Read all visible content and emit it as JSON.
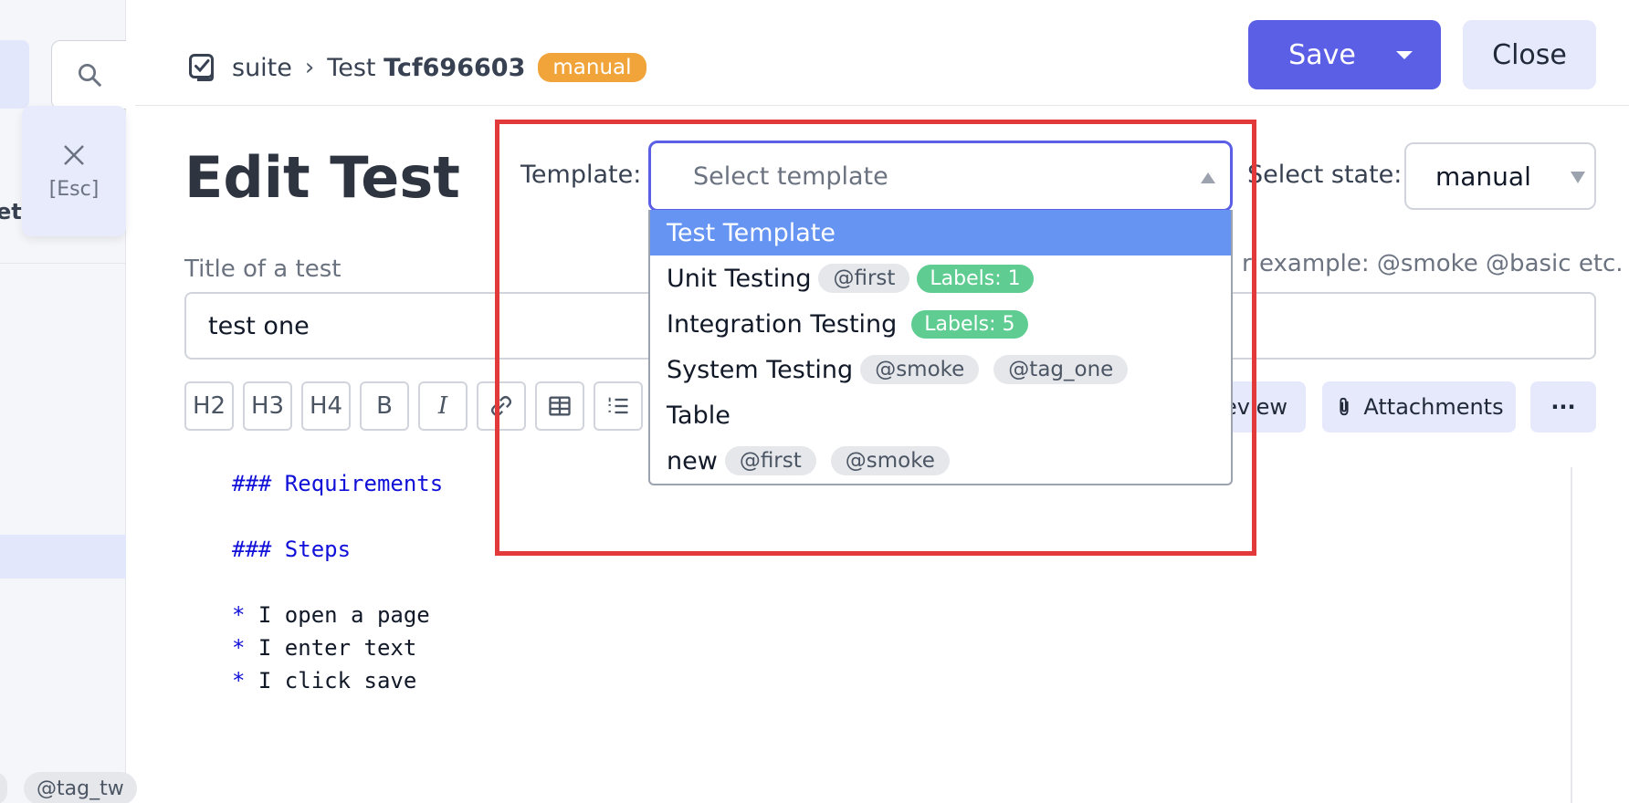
{
  "background": {
    "esc_label": "[Esc]",
    "cut_text": "eta",
    "tag_partial": "@tag_tw"
  },
  "header": {
    "breadcrumb_suite": "suite",
    "breadcrumb_separator": "›",
    "breadcrumb_test_prefix": "Test",
    "breadcrumb_test_id": "Tcf696603",
    "state_badge": "manual",
    "save_label": "Save",
    "close_label": "Close"
  },
  "main": {
    "page_title": "Edit Test",
    "template_label": "Template:",
    "template_placeholder": "Select template",
    "state_label": "Select state:",
    "state_value": "manual",
    "title_label": "Title of a test",
    "tags_hint": "r example: @smoke @basic etc.",
    "title_value": "test one",
    "toolbar": {
      "h2": "H2",
      "h3": "H3",
      "h4": "H4",
      "bold": "B",
      "italic": "I",
      "preview_label": "eview",
      "attachments_label": "Attachments",
      "more_label": "···"
    },
    "editor_lines": [
      {
        "star": "",
        "text": "### Requirements",
        "kind": "head"
      },
      {
        "star": "",
        "text": "### Steps",
        "kind": "head"
      },
      {
        "star": "*",
        "text": " I open a page",
        "kind": "item"
      },
      {
        "star": "*",
        "text": " I enter text",
        "kind": "item"
      },
      {
        "star": "*",
        "text": " I click save",
        "kind": "item"
      }
    ]
  },
  "dropdown": {
    "items": [
      {
        "label": "Test Template",
        "tags": [],
        "labels": "",
        "active": true
      },
      {
        "label": "Unit Testing",
        "tags": [
          "@first"
        ],
        "labels": "Labels: 1",
        "active": false
      },
      {
        "label": "Integration Testing",
        "tags": [],
        "labels": "Labels: 5",
        "active": false
      },
      {
        "label": "System Testing",
        "tags": [
          "@smoke",
          "@tag_one"
        ],
        "labels": "",
        "active": false
      },
      {
        "label": "Table",
        "tags": [],
        "labels": "",
        "active": false
      },
      {
        "label": "new",
        "tags": [
          "@first",
          "@smoke"
        ],
        "labels": "",
        "active": false
      }
    ]
  },
  "colors": {
    "accent": "#5b5fe6",
    "highlight": "#e2393b",
    "badge_manual": "#f0a43a",
    "labels_pill": "#5fcc92",
    "dropdown_active": "#6694f2"
  }
}
